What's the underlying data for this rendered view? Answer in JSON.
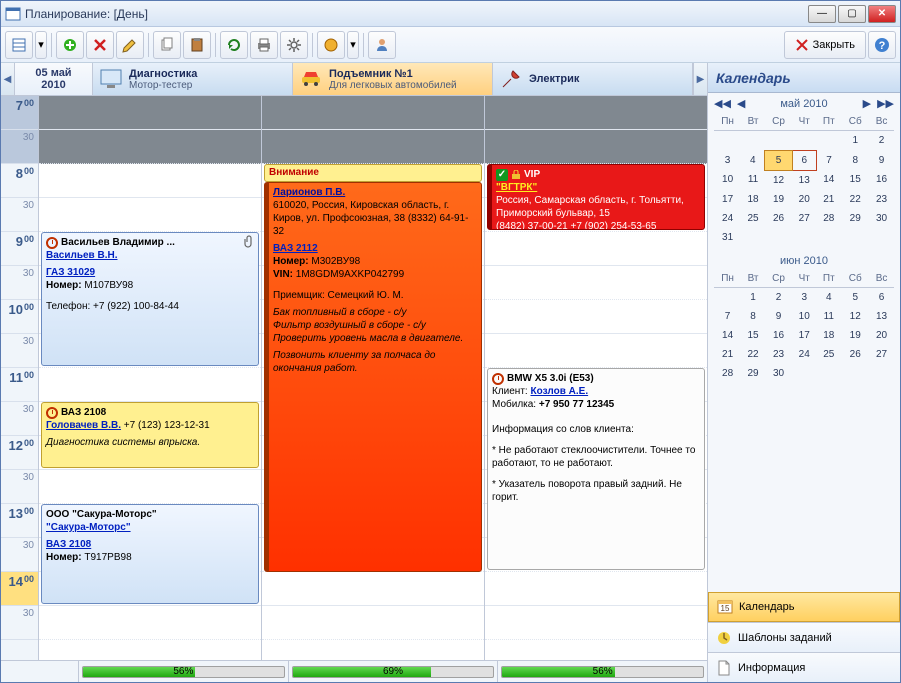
{
  "window": {
    "title": "Планирование: [День]"
  },
  "toolbar": {
    "close_label": "Закрыть"
  },
  "date": {
    "line1": "05 май",
    "line2": "2010"
  },
  "resources": [
    {
      "title": "Диагностика",
      "subtitle": "Мотор-тестер",
      "load": "56%",
      "load_pct": 56
    },
    {
      "title": "Подъемник №1",
      "subtitle": "Для легковых автомобилей",
      "load": "69%",
      "load_pct": 69
    },
    {
      "title": "Электрик",
      "subtitle": "",
      "load": "56%",
      "load_pct": 56
    }
  ],
  "time_slots": [
    "7",
    "30",
    "8",
    "30",
    "9",
    "30",
    "10",
    "30",
    "11",
    "30",
    "12",
    "30",
    "13",
    "30",
    "14",
    "30"
  ],
  "time_mins": "00",
  "appointments": {
    "vasilyev": {
      "title": "Васильев Владимир ...",
      "client": "Васильев В.Н.",
      "car": "ГАЗ 31029",
      "num_lbl": "Номер:",
      "num": "М107ВУ98",
      "phone_lbl": "Телефон:",
      "phone": "+7 (922) 100-84-44"
    },
    "vaz2108": {
      "title": "ВАЗ 2108",
      "client": "Головачев В.В.",
      "client_phone": "+7 (123) 123-12-31",
      "desc": "Диагностика системы впрыска."
    },
    "sakura": {
      "title": "ООО \"Сакура-Моторс\"",
      "client": "\"Сакура-Моторс\"",
      "car": "ВАЗ 2108",
      "num_lbl": "Номер:",
      "num": "Т917РВ98"
    },
    "vnimanie": {
      "title": "Внимание",
      "client": "Ларионов П.В.",
      "addr": "610020, Россия, Кировская область, г. Киров, ул. Профсоюзная, 38 (8332) 64-91-32",
      "car": "ВАЗ 2112",
      "num_lbl": "Номер:",
      "num": "М302ВУ98",
      "vin_lbl": "VIN:",
      "vin": "1M8GDM9AXKP042799",
      "receiver_lbl": "Приемщик:",
      "receiver": "Семецкий Ю. М.",
      "desc1": "Бак топливный в сборе - с/у",
      "desc2": "Фильтр воздушный в сборе - с/у",
      "desc3": "Проверить уровень масла в двигателе.",
      "desc4": "Позвонить клиенту за полчаса до окончания работ."
    },
    "vip": {
      "title": "VIP",
      "client": "\"ВГТРК\"",
      "addr": "Россия, Самарская область, г. Тольятти, Приморский бульвар, 15",
      "phones": "(8482) 37-00-21 +7 (902) 254-53-65"
    },
    "bmw": {
      "title": "BMW X5 3.0i (E53)",
      "client_lbl": "Клиент:",
      "client": "Козлов А.Е.",
      "mob_lbl": "Мобилка:",
      "mob": "+7 950 77 12345",
      "info_head": "Информация со слов клиента:",
      "info1": "* Не работают стеклоочистители. Точнее то работают, то не работают.",
      "info2": "* Указатель поворота правый задний. Не горит."
    }
  },
  "sidebar": {
    "title": "Календарь",
    "may": "май 2010",
    "june": "июн 2010",
    "dow": [
      "Пн",
      "Вт",
      "Ср",
      "Чт",
      "Пт",
      "Сб",
      "Вс"
    ],
    "items": {
      "calendar": "Календарь",
      "templates": "Шаблоны заданий",
      "info": "Информация"
    }
  }
}
